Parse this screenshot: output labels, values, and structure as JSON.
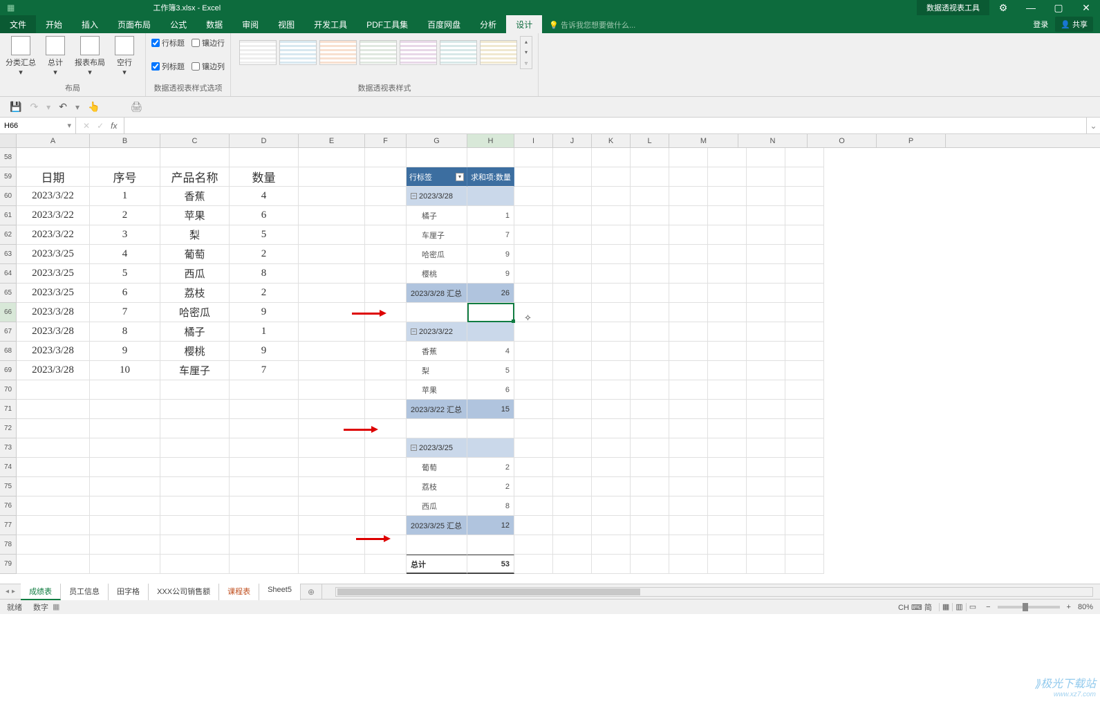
{
  "title": {
    "doc": "工作簿3.xlsx - Excel",
    "context_tool": "数据透视表工具"
  },
  "win_controls": {
    "ribbon_opts": "⚙",
    "min": "—",
    "max": "▢",
    "close": "✕"
  },
  "tabs": {
    "file": "文件",
    "items": [
      "开始",
      "插入",
      "页面布局",
      "公式",
      "数据",
      "审阅",
      "视图",
      "开发工具",
      "PDF工具集",
      "百度网盘",
      "分析",
      "设计"
    ],
    "active": "设计",
    "tell_me": "告诉我您想要做什么...",
    "login": "登录",
    "share": "共享"
  },
  "ribbon": {
    "layout_group": "布局",
    "btn_subtotal": "分类汇总",
    "btn_grandtotal": "总计",
    "btn_report_layout": "报表布局",
    "btn_blankrow": "空行",
    "style_opts_group": "数据透视表样式选项",
    "chk_row_headers": "行标题",
    "chk_col_headers": "列标题",
    "chk_banded_rows": "镶边行",
    "chk_banded_cols": "镶边列",
    "styles_group": "数据透视表样式"
  },
  "qat": {
    "save": "💾",
    "redo": "↷",
    "undo": "↶",
    "touch": "👆",
    "print": "🖨"
  },
  "namebox": "H66",
  "fx": {
    "cancel": "✕",
    "accept": "✓",
    "fx": "fx"
  },
  "columns": [
    "A",
    "B",
    "C",
    "D",
    "E",
    "F",
    "G",
    "H",
    "I",
    "J",
    "K",
    "L",
    "M",
    "N",
    "O",
    "P"
  ],
  "row_start": 58,
  "data_table": {
    "headers": [
      "日期",
      "序号",
      "产品名称",
      "数量"
    ],
    "rows": [
      [
        "2023/3/22",
        "1",
        "香蕉",
        "4"
      ],
      [
        "2023/3/22",
        "2",
        "苹果",
        "6"
      ],
      [
        "2023/3/22",
        "3",
        "梨",
        "5"
      ],
      [
        "2023/3/25",
        "4",
        "葡萄",
        "2"
      ],
      [
        "2023/3/25",
        "5",
        "西瓜",
        "8"
      ],
      [
        "2023/3/25",
        "6",
        "荔枝",
        "2"
      ],
      [
        "2023/3/28",
        "7",
        "哈密瓜",
        "9"
      ],
      [
        "2023/3/28",
        "8",
        "橘子",
        "1"
      ],
      [
        "2023/3/28",
        "9",
        "樱桃",
        "9"
      ],
      [
        "2023/3/28",
        "10",
        "车厘子",
        "7"
      ]
    ]
  },
  "pivot": {
    "row_label_header": "行标签",
    "value_header": "求和项:数量",
    "groups": [
      {
        "key": "2023/3/28",
        "items": [
          [
            "橘子",
            "1"
          ],
          [
            "车厘子",
            "7"
          ],
          [
            "哈密瓜",
            "9"
          ],
          [
            "樱桃",
            "9"
          ]
        ],
        "subtotal_label": "2023/3/28 汇总",
        "subtotal": "26"
      },
      {
        "key": "2023/3/22",
        "items": [
          [
            "香蕉",
            "4"
          ],
          [
            "梨",
            "5"
          ],
          [
            "苹果",
            "6"
          ]
        ],
        "subtotal_label": "2023/3/22 汇总",
        "subtotal": "15"
      },
      {
        "key": "2023/3/25",
        "items": [
          [
            "葡萄",
            "2"
          ],
          [
            "荔枝",
            "2"
          ],
          [
            "西瓜",
            "8"
          ]
        ],
        "subtotal_label": "2023/3/25 汇总",
        "subtotal": "12"
      }
    ],
    "grand_label": "总计",
    "grand_value": "53"
  },
  "sheets": {
    "tabs": [
      "成绩表",
      "员工信息",
      "田字格",
      "XXX公司销售额",
      "课程表",
      "Sheet5"
    ],
    "active": "成绩表"
  },
  "status": {
    "ready": "就绪",
    "extra": "数字",
    "ime": "CH ⌨ 简",
    "zoom": "80%",
    "minus": "−",
    "plus": "+"
  },
  "watermark": {
    "main": "⟫极光下载站",
    "sub": "www.xz7.com"
  }
}
